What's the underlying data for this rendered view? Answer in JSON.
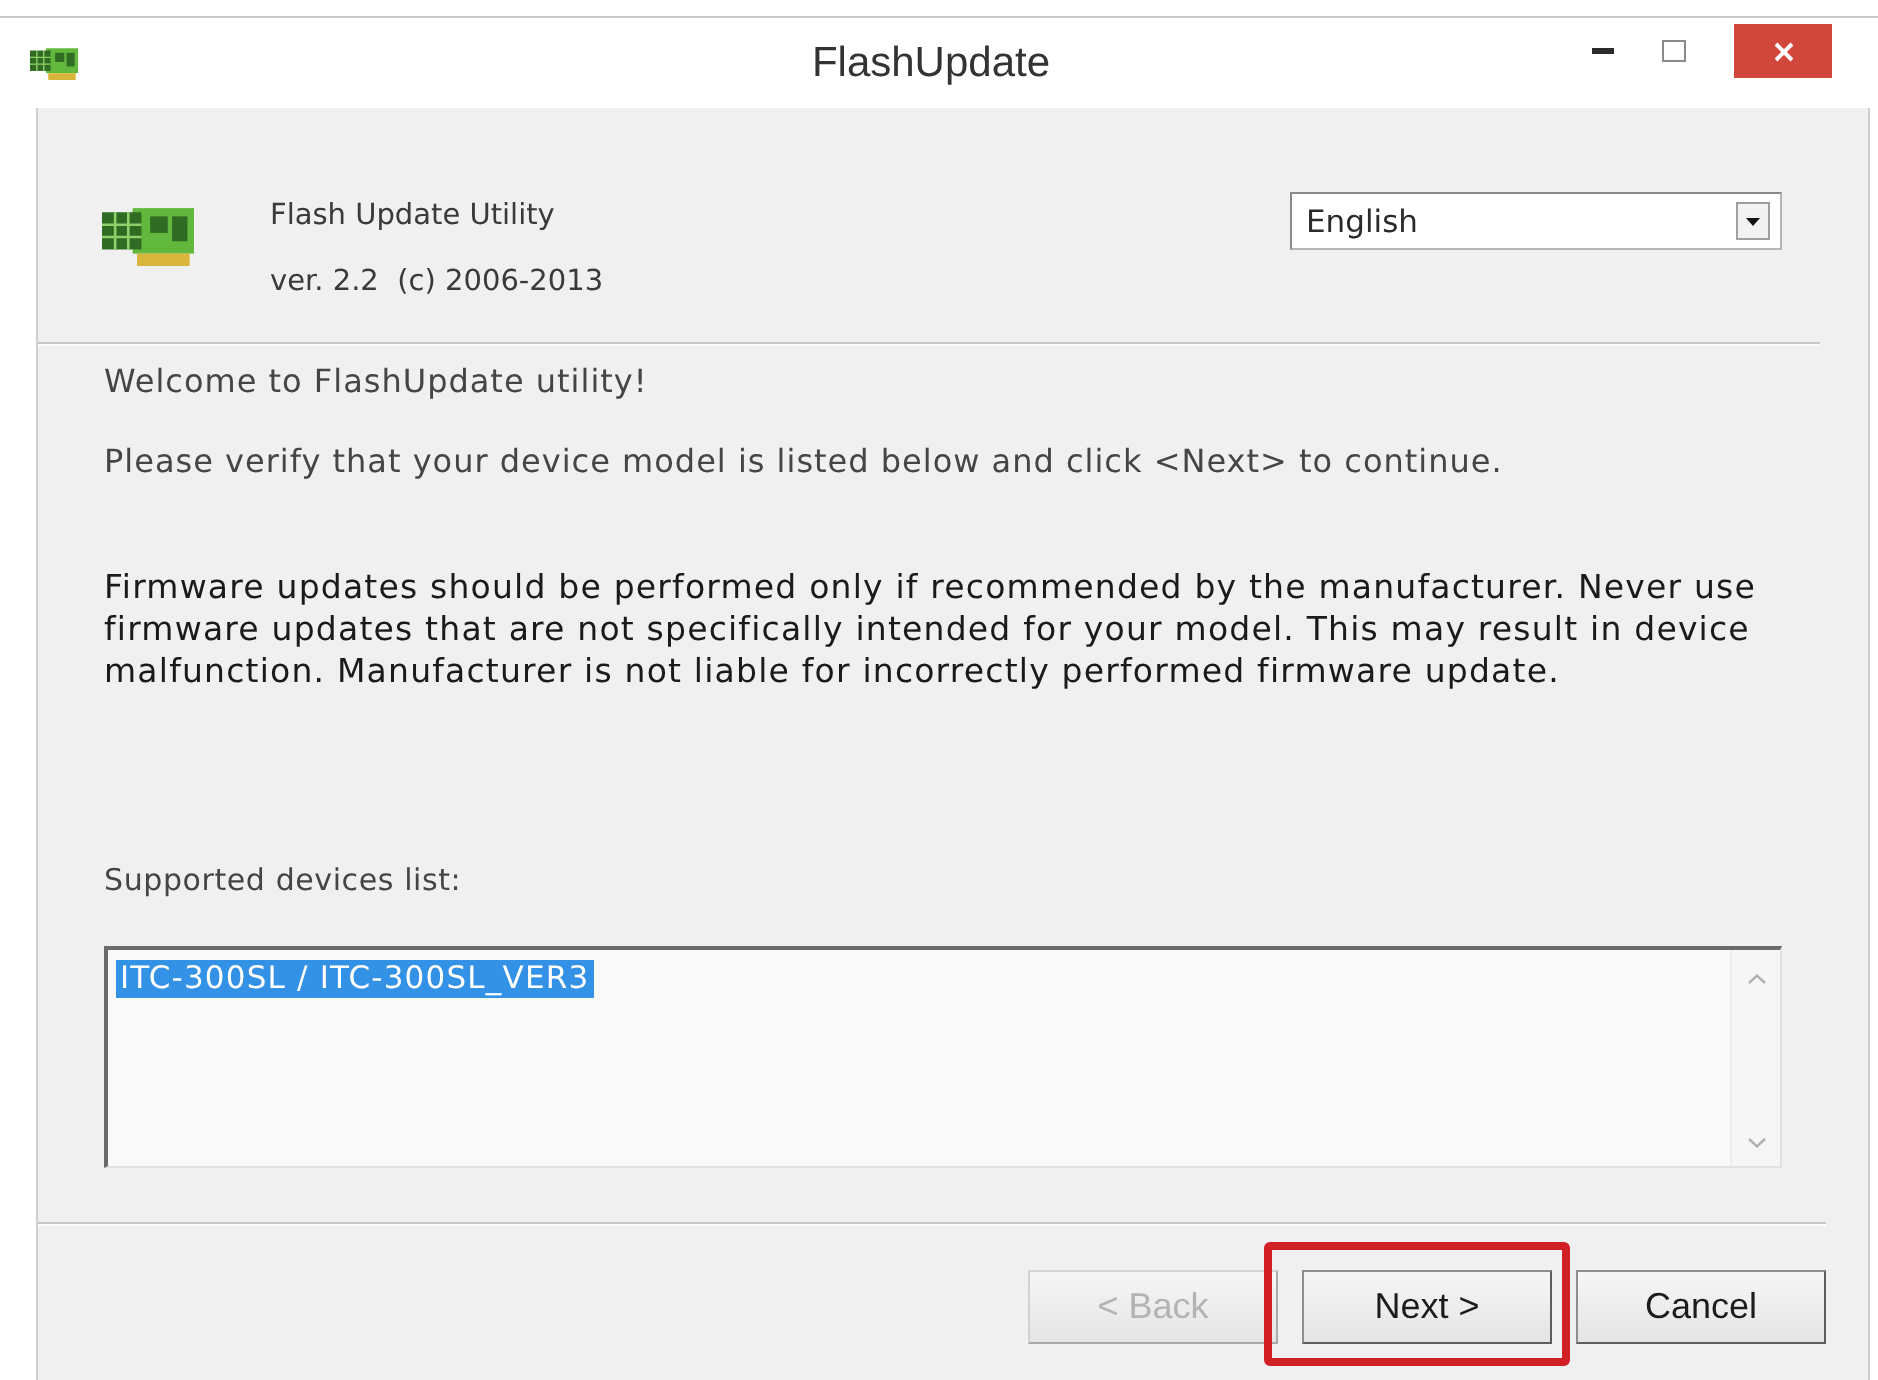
{
  "window": {
    "title": "FlashUpdate"
  },
  "header": {
    "product": "Flash Update Utility",
    "version": "ver. 2.2  (c) 2006-2013",
    "language": {
      "value": "English"
    }
  },
  "messages": [
    {
      "kind": "normal",
      "text": "Welcome to FlashUpdate utility!"
    },
    {
      "kind": "normal",
      "text": "Please verify that your device model is listed below and click <Next> to continue."
    },
    {
      "kind": "warning",
      "text": "Firmware updates should be performed only if recommended by the manufacturer. Never use firmware updates that are not specifically intended for your model. This may result in device malfunction. Manufacturer is not liable for incorrectly performed firmware update."
    }
  ],
  "devices": {
    "label": "Supported devices list:",
    "items": [
      {
        "text": "ITC-300SL / ITC-300SL_VER3",
        "selected": true
      }
    ]
  },
  "buttons": [
    {
      "label": "< Back",
      "disabled": true,
      "highlighted": false
    },
    {
      "label": "Next >",
      "disabled": false,
      "highlighted": true
    },
    {
      "label": "Cancel",
      "disabled": false,
      "highlighted": false
    }
  ]
}
